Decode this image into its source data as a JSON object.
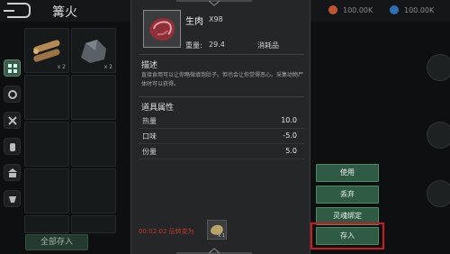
{
  "header": {
    "title": "篝火"
  },
  "currencies": [
    {
      "value": "100.00K",
      "color": "#c0552c"
    },
    {
      "value": "100.00K",
      "color": "#2c6fb5"
    }
  ],
  "grid": {
    "slots": [
      {
        "icon": "firewood-icon",
        "quantity": "x 2"
      },
      {
        "icon": "stone-icon",
        "quantity": "x 2"
      }
    ]
  },
  "store_all_label": "全部存入",
  "item": {
    "name": "生肉",
    "count": "X98",
    "weight_label": "重量:",
    "weight_value": "29.4",
    "type": "消耗品",
    "desc_title": "描述",
    "description": "直接食用可以让你略微填饱肚子。但也会让你觉得恶心。采集动物尸体时可以获得。",
    "attr_title": "道具属性",
    "attributes": [
      {
        "label": "热量",
        "value": "10.0"
      },
      {
        "label": "口味",
        "value": "-5.0"
      },
      {
        "label": "份量",
        "value": "5.0"
      }
    ],
    "timer": "00:02:02 后转变为",
    "result_quantity": "x 1"
  },
  "actions": {
    "use": "使用",
    "discard": "丢弃",
    "soulbind": "灵魂绑定",
    "store": "存入"
  },
  "colors": {
    "button_green": "#2f5a43",
    "highlight_red": "#d0181f",
    "timer_red": "#c0392b"
  }
}
